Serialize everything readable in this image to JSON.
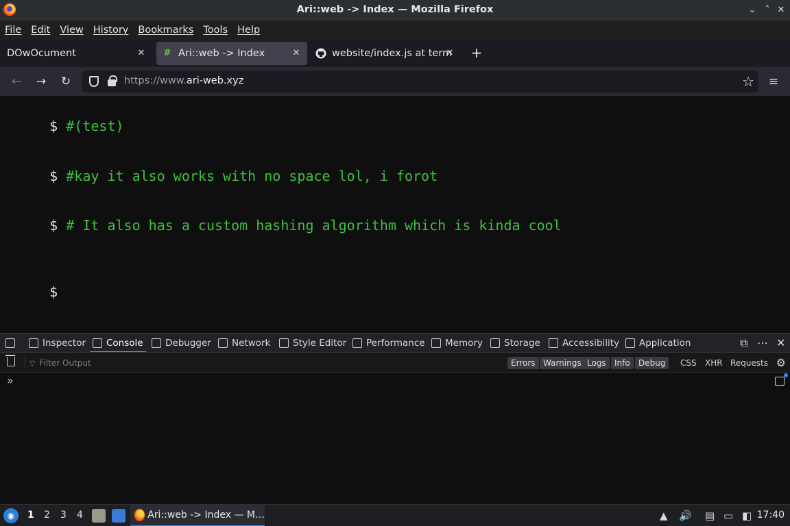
{
  "window": {
    "title": "Ari::web -> Index — Mozilla Firefox",
    "minimize": "⌄",
    "maximize": "˄",
    "close": "✕"
  },
  "menu": [
    "File",
    "Edit",
    "View",
    "History",
    "Bookmarks",
    "Tools",
    "Help"
  ],
  "tabs": [
    {
      "label": "DOwOcument",
      "favicon": "",
      "close": "✕"
    },
    {
      "label": "Ari::web -> Index",
      "favicon": "#",
      "close": "✕"
    },
    {
      "label": "website/index.js at termi",
      "favicon": "github-icon",
      "close": "✕"
    }
  ],
  "new_tab": "+",
  "nav": {
    "back": "←",
    "forward": "→",
    "reload": "↻",
    "url_prefix": "https://www.",
    "url_domain": "ari-web.xyz",
    "bookmark_star": "☆",
    "menu": "≡"
  },
  "terminal": {
    "lines": [
      {
        "prompt": "$",
        "text": "#(test)"
      },
      {
        "prompt": "$",
        "text": "#kay it also works with no space lol, i forot"
      },
      {
        "prompt": "$",
        "text": "# It also has a custom hashing algorithm which is kinda cool"
      },
      {
        "prompt": "$",
        "text": ""
      }
    ]
  },
  "devtools": {
    "tabs": [
      "Inspector",
      "Console",
      "Debugger",
      "Network",
      "Style Editor",
      "Performance",
      "Memory",
      "Storage",
      "Accessibility",
      "Application"
    ],
    "selected_tab": "Console",
    "filter_placeholder": "Filter Output",
    "levels": [
      "Errors",
      "Warnings",
      "Logs",
      "Info",
      "Debug"
    ],
    "types": [
      "CSS",
      "XHR",
      "Requests"
    ],
    "prompt_chevron": "»"
  },
  "taskbar": {
    "workspaces": [
      "1",
      "2",
      "3",
      "4"
    ],
    "active_workspace": "1",
    "task_label": "Ari::web -> Index — M…",
    "clock": "17:40"
  },
  "colors": {
    "terminal_green": "#3fc03f",
    "accent": "#54a3ff"
  }
}
